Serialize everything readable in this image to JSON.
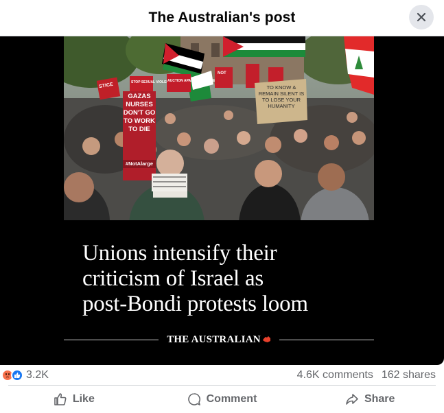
{
  "header": {
    "title": "The Australian's post"
  },
  "post": {
    "photo_signs": {
      "sign_nurses": "GAZAS NURSES DON'T GO TO WORK TO DIE",
      "sign_hashtag": "#NotAlarge",
      "sign_silent": "TO KNOW & REMAIN SILENT IS TO LOSE YOUR HUMANITY",
      "sign_apartheid": "AUCTION APARTHEID ISRAEL",
      "sign_justice": "STICE",
      "sign_violence": "STOP SEXUAL VIOLENCE IN WAR",
      "sign_not": "NOT"
    },
    "headline_lines": [
      "Unions intensify their",
      "criticism of Israel as",
      "post-Bondi protests loom"
    ],
    "brand": "THE AUSTRALIAN"
  },
  "stats": {
    "reactions": "3.2K",
    "comments": "4.6K comments",
    "shares": "162 shares"
  },
  "actions": {
    "like": "Like",
    "comment": "Comment",
    "share": "Share"
  },
  "colors": {
    "text_primary": "#050505",
    "text_secondary": "#65676b",
    "angry_reaction": "#f7714c",
    "like_reaction": "#1877f2",
    "brand_accent": "#e8412c"
  }
}
